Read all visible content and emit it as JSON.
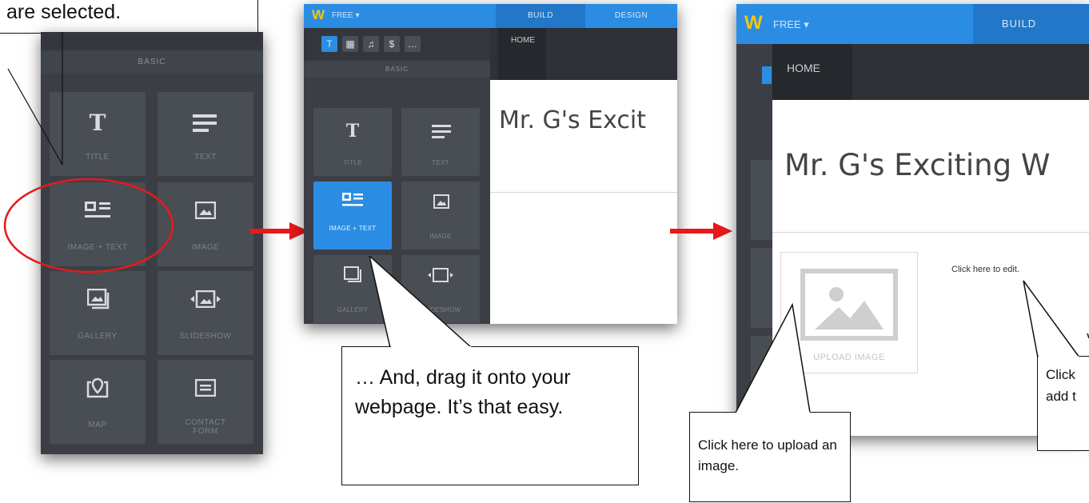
{
  "callout_top": {
    "text": "are selected."
  },
  "panel1": {
    "section_label": "BASIC",
    "tiles": [
      {
        "label": "TITLE",
        "icon": "title-icon"
      },
      {
        "label": "TEXT",
        "icon": "text-icon"
      },
      {
        "label": "IMAGE + TEXT",
        "icon": "image-text-icon"
      },
      {
        "label": "IMAGE",
        "icon": "image-icon"
      },
      {
        "label": "GALLERY",
        "icon": "gallery-icon"
      },
      {
        "label": "SLIDESHOW",
        "icon": "slideshow-icon"
      },
      {
        "label": "MAP",
        "icon": "map-icon"
      },
      {
        "label": "CONTACT FORM",
        "icon": "contact-form-icon"
      }
    ]
  },
  "panel2": {
    "plan": "FREE",
    "tabs": [
      "BUILD",
      "DESIGN"
    ],
    "page_tab": "HOME",
    "section_label": "BASIC",
    "site_title": "Mr. G's Excit",
    "tiles": [
      {
        "label": "TITLE"
      },
      {
        "label": "TEXT"
      },
      {
        "label": "IMAGE + TEXT"
      },
      {
        "label": "IMAGE"
      },
      {
        "label": "GALLERY"
      },
      {
        "label": "SLIDESHOW"
      }
    ]
  },
  "panel3": {
    "plan": "FREE",
    "tab": "BUILD",
    "page_tab": "HOME",
    "site_title": "Mr. G's Exciting W",
    "upload_label": "UPLOAD IMAGE",
    "edit_hint": "Click here to edit."
  },
  "callout_mid": {
    "text": "… And, drag it onto your webpage. It’s that easy."
  },
  "callout_upload": {
    "text": "Click here to upload an image."
  },
  "callout_right": {
    "line1": "Click",
    "line2": "add t"
  },
  "colors": {
    "accent_blue": "#2a8de3",
    "arrow_red": "#e8191b",
    "panel_dark": "#3b3f45",
    "tile": "#494d54"
  }
}
